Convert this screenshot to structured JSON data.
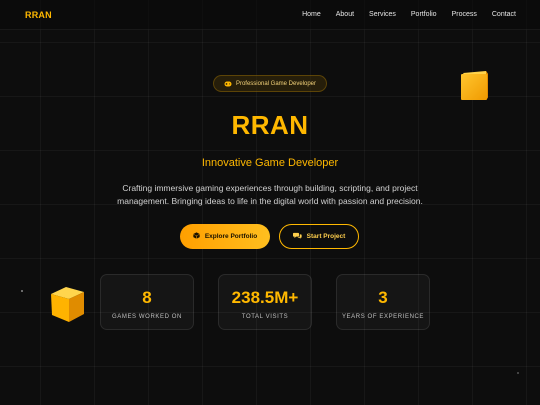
{
  "nav": {
    "logo": "RRAN",
    "links": [
      "Home",
      "About",
      "Services",
      "Portfolio",
      "Process",
      "Contact"
    ]
  },
  "hero": {
    "badge": "Professional Game Developer",
    "badge_icon": "gamepad-icon",
    "title": "RRAN",
    "subtitle": "Innovative Game Developer",
    "description": "Crafting immersive gaming experiences through building, scripting, and project management. Bringing ideas to life in the digital world with passion and precision.",
    "primary_button": "Explore Portfolio",
    "primary_icon": "cube-icon",
    "secondary_button": "Start Project",
    "secondary_icon": "chat-icon"
  },
  "stats": [
    {
      "value": "8",
      "label": "GAMES WORKED ON"
    },
    {
      "value": "238.5M+",
      "label": "TOTAL VISITS"
    },
    {
      "value": "3",
      "label": "YEARS OF EXPERIENCE"
    }
  ],
  "colors": {
    "accent": "#ffb800",
    "background": "#0d0d0d",
    "button_gradient_start": "#ff9f00",
    "button_gradient_end": "#ffbf1f"
  }
}
